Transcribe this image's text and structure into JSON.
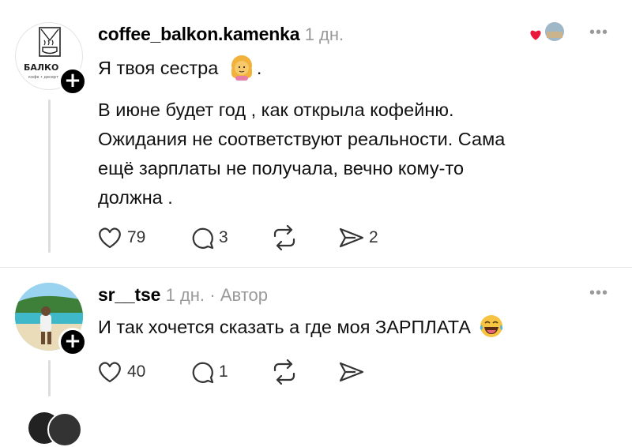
{
  "comments": [
    {
      "username": "coffee_balkon.kamenka",
      "time": "1 дн.",
      "author_tag": "",
      "avatar_text": "БАЛКО",
      "more": "•••",
      "first_line": "Я твоя сестра",
      "first_line_end": ".",
      "body_lines": [
        "В июне будет год , как открыла кофейню.",
        "Ожидания не соответствуют реальности. Сама",
        "ещё  зарплаты  не получала, вечно кому-то",
        "должна ."
      ],
      "likes": "79",
      "replies": "3",
      "reposts": "",
      "shares": "2"
    },
    {
      "username": "sr__tse",
      "time": "1 дн.",
      "author_tag": "· Автор",
      "more": "•••",
      "first_line": "И так хочется сказать а где моя ЗАРПЛАТА",
      "likes": "40",
      "replies": "1",
      "reposts": "",
      "shares": ""
    }
  ],
  "colors": {
    "accent_heart": "#e8193c",
    "meta_gray": "#9a9a9a",
    "line_gray": "#dddddd"
  }
}
